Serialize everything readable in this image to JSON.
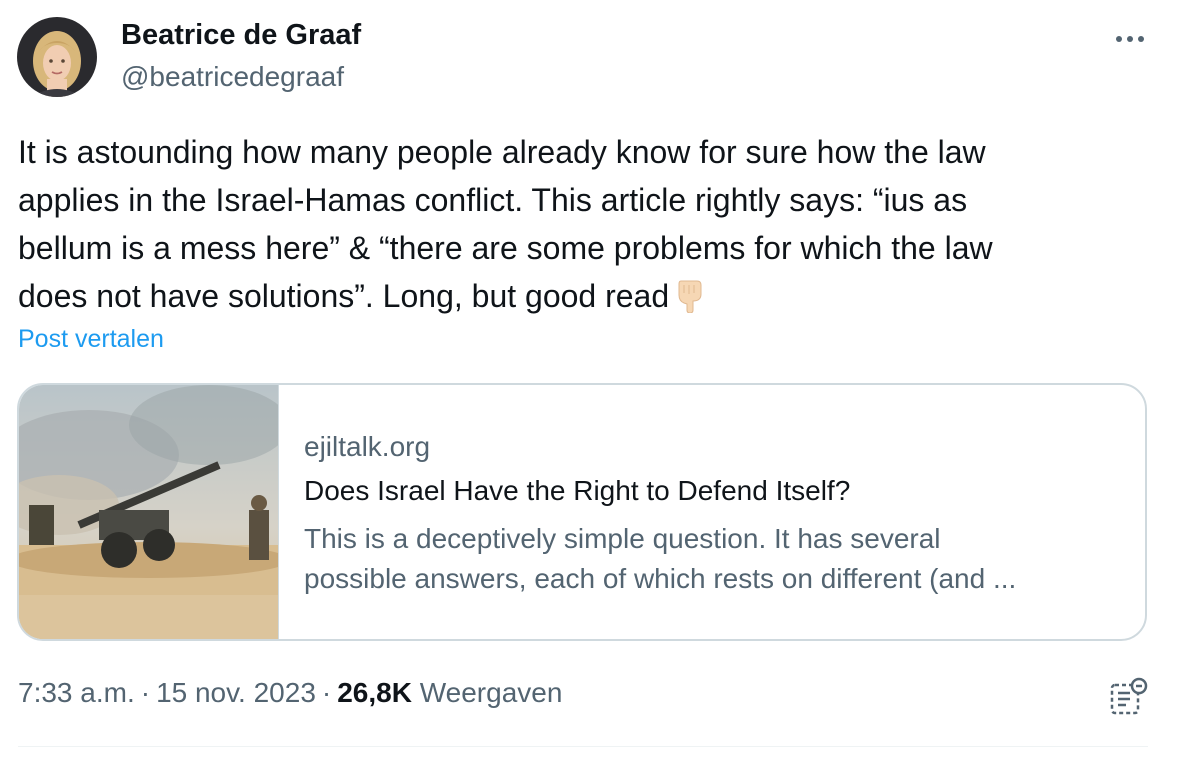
{
  "author": {
    "display_name": "Beatrice de Graaf",
    "handle": "@beatricedegraaf"
  },
  "tweet": {
    "text_lines": [
      "It is astounding how many people already know for sure how the law",
      "applies in the Israel-Hamas conflict. This article rightly says: “ius as",
      "bellum is a mess here” & “there are some problems for which the law",
      "does not have solutions”. Long, but good read"
    ],
    "emoji_icon": "backhand-index-pointing-down-icon",
    "translate_label": "Post vertalen"
  },
  "card": {
    "domain": "ejiltalk.org",
    "title": "Does Israel Have the Right to Defend Itself?",
    "description_lines": [
      "This is a deceptively simple question. It has several",
      "possible answers, each of which rests on different (and ..."
    ]
  },
  "meta": {
    "time": "7:33 a.m.",
    "separator": "·",
    "date": "15 nov. 2023",
    "views_count": "26,8K",
    "views_label": "Weergaven"
  },
  "icons": {
    "more": "more-horizontal-icon",
    "analytics": "analytics-icon"
  },
  "colors": {
    "link": "#1d9bf0",
    "secondary_text": "#536471",
    "primary_text": "#0f1419",
    "border": "#cfd9de"
  }
}
